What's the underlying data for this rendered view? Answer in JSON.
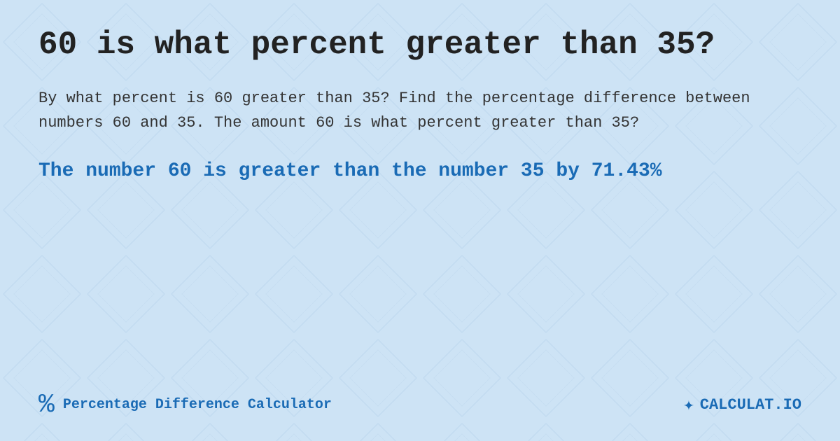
{
  "page": {
    "title": "60 is what percent greater than 35?",
    "description": "By what percent is 60 greater than 35? Find the percentage difference between numbers 60 and 35. The amount 60 is what percent greater than 35?",
    "result": "The number 60 is greater than the number 35 by 71.43%",
    "footer": {
      "label": "Percentage Difference Calculator",
      "logo": "CALCULAT.IO"
    }
  },
  "background": {
    "color": "#cde3f5",
    "pattern_color": "#b8d5ee"
  }
}
